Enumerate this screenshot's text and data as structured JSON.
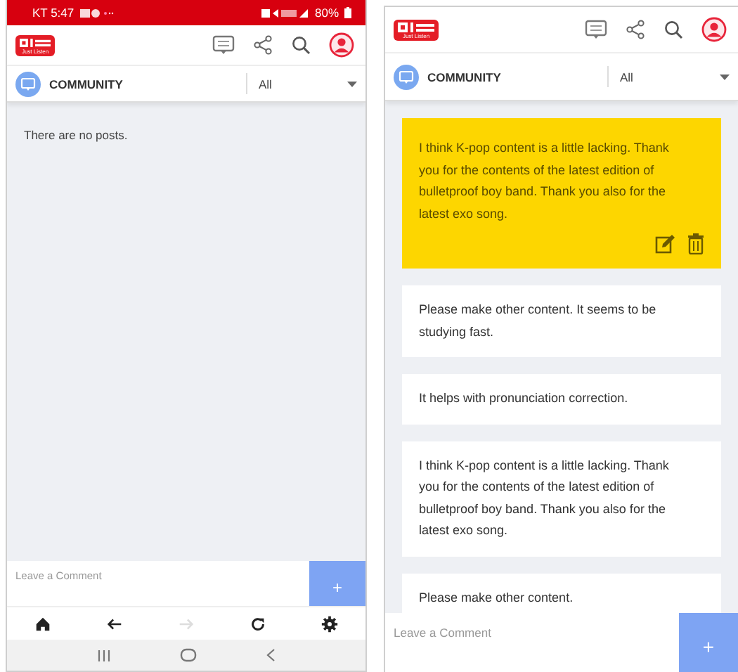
{
  "screens": [
    {
      "status_bar": {
        "carrier_time": "KT 5:47",
        "battery": "80%"
      },
      "logo": {
        "tagline": "Just Listen"
      },
      "community": {
        "title": "COMMUNITY",
        "filter": "All"
      },
      "empty_message": "There are no posts.",
      "comment": {
        "placeholder": "Leave a Comment",
        "button": "+"
      },
      "browser_nav": [
        {
          "kind": "home",
          "disabled": false
        },
        {
          "kind": "back",
          "disabled": false
        },
        {
          "kind": "forward",
          "disabled": true
        },
        {
          "kind": "reload",
          "disabled": false
        },
        {
          "kind": "settings",
          "disabled": false
        }
      ],
      "system_nav": true
    },
    {
      "logo": {
        "tagline": "Just Listen"
      },
      "community": {
        "title": "COMMUNITY",
        "filter": "All"
      },
      "posts": [
        {
          "text": "I think K-pop content is a little lacking. Thank you for the contents of the latest edition of bulletproof boy band. Thank you also for the latest exo song.",
          "selected": true
        },
        {
          "text": "Please make other content. It seems to be studying fast.",
          "selected": false
        },
        {
          "text": "It helps with pronunciation correction.",
          "selected": false
        },
        {
          "text": "I think K-pop content is a little lacking. Thank you for the contents of the latest edition of bulletproof boy band. Thank you also for the latest exo song.",
          "selected": false
        },
        {
          "text": "Please make other content.",
          "selected": false
        }
      ],
      "comment": {
        "placeholder": "Leave a Comment",
        "button": "+"
      }
    }
  ]
}
